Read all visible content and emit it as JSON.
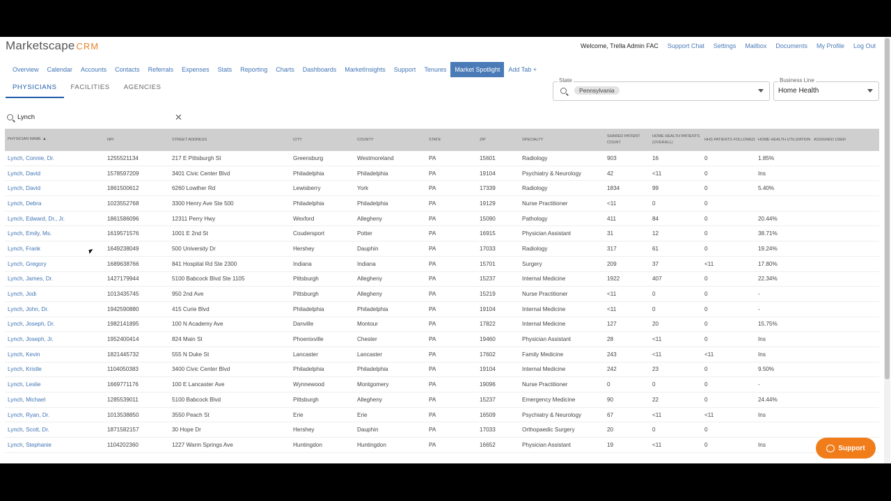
{
  "header": {
    "logo": "Marketscape",
    "logo_suffix": "CRM",
    "welcome": "Welcome, Trella Admin FAC",
    "links": [
      "Support Chat",
      "Settings",
      "Mailbox",
      "Documents",
      "My Profile",
      "Log Out"
    ]
  },
  "nav_tabs": [
    {
      "label": "Overview"
    },
    {
      "label": "Calendar"
    },
    {
      "label": "Accounts"
    },
    {
      "label": "Contacts"
    },
    {
      "label": "Referrals"
    },
    {
      "label": "Expenses"
    },
    {
      "label": "Stats"
    },
    {
      "label": "Reporting"
    },
    {
      "label": "Charts"
    },
    {
      "label": "Dashboards"
    },
    {
      "label": "MarketInsights"
    },
    {
      "label": "Support"
    },
    {
      "label": "Tenures"
    },
    {
      "label": "Market Spotlight"
    },
    {
      "label": "Add Tab +"
    }
  ],
  "active_nav": "Market Spotlight",
  "sub_tabs": [
    "PHYSICIANS",
    "FACILITIES",
    "AGENCIES"
  ],
  "filters": {
    "state_label": "State",
    "state_chip": "Pennsylvania",
    "business_line_label": "Business Line",
    "business_line_value": "Home Health"
  },
  "search": {
    "value": "Lynch"
  },
  "table": {
    "columns": [
      "PHYSICIAN NAME",
      "NPI",
      "STREET ADDRESS",
      "CITY",
      "COUNTY",
      "STATE",
      "ZIP",
      "SPECIALTY",
      "SHARED PATIENT COUNT",
      "HOME HEALTH PATIENTS (OVERALL)",
      "HHS PATIENTS FOLLOWED",
      "HOME HEALTH UTILIZATION",
      "ASSIGNED USER"
    ],
    "rows": [
      [
        "Lynch, Connie, Dr.",
        "1255521134",
        "217 E Pittsburgh St",
        "Greensburg",
        "Westmoreland",
        "PA",
        "15601",
        "Radiology",
        "903",
        "16",
        "0",
        "1.85%",
        ""
      ],
      [
        "Lynch, David",
        "1578597209",
        "3401 Civic Center Blvd",
        "Philadelphia",
        "Philadelphia",
        "PA",
        "19104",
        "Psychiatry & Neurology",
        "42",
        "<11",
        "0",
        "Ins",
        ""
      ],
      [
        "Lynch, David",
        "1861500612",
        "6260 Lowther Rd",
        "Lewisberry",
        "York",
        "PA",
        "17339",
        "Radiology",
        "1834",
        "99",
        "0",
        "5.40%",
        ""
      ],
      [
        "Lynch, Debra",
        "1023552768",
        "3300 Henry Ave Ste 500",
        "Philadelphia",
        "Philadelphia",
        "PA",
        "19129",
        "Nurse Practitioner",
        "<11",
        "0",
        "0",
        "",
        ""
      ],
      [
        "Lynch, Edward, Dr., Jr.",
        "1861586096",
        "12311 Perry Hwy",
        "Wexford",
        "Allegheny",
        "PA",
        "15090",
        "Pathology",
        "411",
        "84",
        "0",
        "20.44%",
        ""
      ],
      [
        "Lynch, Emily, Ms.",
        "1619571576",
        "1001 E 2nd St",
        "Coudersport",
        "Potter",
        "PA",
        "16915",
        "Physician Assistant",
        "31",
        "12",
        "0",
        "38.71%",
        ""
      ],
      [
        "Lynch, Frank",
        "1649238049",
        "500 University Dr",
        "Hershey",
        "Dauphin",
        "PA",
        "17033",
        "Radiology",
        "317",
        "61",
        "0",
        "19.24%",
        ""
      ],
      [
        "Lynch, Gregory",
        "1689638766",
        "841 Hospital Rd Ste 2300",
        "Indiana",
        "Indiana",
        "PA",
        "15701",
        "Surgery",
        "209",
        "37",
        "<11",
        "17.80%",
        ""
      ],
      [
        "Lynch, James, Dr.",
        "1427179944",
        "5100 Babcock Blvd Ste 1105",
        "Pittsburgh",
        "Allegheny",
        "PA",
        "15237",
        "Internal Medicine",
        "1922",
        "407",
        "0",
        "22.34%",
        ""
      ],
      [
        "Lynch, Jodi",
        "1013435745",
        "950 2nd Ave",
        "Pittsburgh",
        "Allegheny",
        "PA",
        "15219",
        "Nurse Practitioner",
        "<11",
        "0",
        "0",
        "-",
        ""
      ],
      [
        "Lynch, John, Dr.",
        "1942590880",
        "415 Curie Blvd",
        "Philadelphia",
        "Philadelphia",
        "PA",
        "19104",
        "Internal Medicine",
        "<11",
        "0",
        "0",
        "-",
        ""
      ],
      [
        "Lynch, Joseph, Dr.",
        "1982141895",
        "100 N Academy Ave",
        "Danville",
        "Montour",
        "PA",
        "17822",
        "Internal Medicine",
        "127",
        "20",
        "0",
        "15.75%",
        ""
      ],
      [
        "Lynch, Joseph, Jr.",
        "1952400414",
        "824 Main St",
        "Phoenixville",
        "Chester",
        "PA",
        "19460",
        "Physician Assistant",
        "28",
        "<11",
        "0",
        "Ins",
        ""
      ],
      [
        "Lynch, Kevin",
        "1821445732",
        "555 N Duke St",
        "Lancaster",
        "Lancaster",
        "PA",
        "17602",
        "Family Medicine",
        "243",
        "<11",
        "<11",
        "Ins",
        ""
      ],
      [
        "Lynch, Kristle",
        "1104050383",
        "3400 Civic Center Blvd",
        "Philadelphia",
        "Philadelphia",
        "PA",
        "19104",
        "Internal Medicine",
        "242",
        "23",
        "0",
        "9.50%",
        ""
      ],
      [
        "Lynch, Leslie",
        "1669771176",
        "100 E Lancaster Ave",
        "Wynnewood",
        "Montgomery",
        "PA",
        "19096",
        "Nurse Practitioner",
        "0",
        "0",
        "0",
        "-",
        ""
      ],
      [
        "Lynch, Michael",
        "1285539011",
        "5100 Babcock Blvd",
        "Pittsburgh",
        "Allegheny",
        "PA",
        "15237",
        "Emergency Medicine",
        "90",
        "22",
        "0",
        "24.44%",
        ""
      ],
      [
        "Lynch, Ryan, Dr.",
        "1013538850",
        "3550 Peach St",
        "Erie",
        "Erie",
        "PA",
        "16509",
        "Psychiatry & Neurology",
        "67",
        "<11",
        "<11",
        "Ins",
        ""
      ],
      [
        "Lynch, Scott, Dr.",
        "1871582157",
        "30 Hope Dr",
        "Hershey",
        "Dauphin",
        "PA",
        "17033",
        "Orthopaedic Surgery",
        "20",
        "0",
        "0",
        "",
        ""
      ],
      [
        "Lynch, Stephanie",
        "1104202360",
        "1227 Warm Springs Ave",
        "Huntingdon",
        "Huntingdon",
        "PA",
        "16652",
        "Physician Assistant",
        "19",
        "<11",
        "0",
        "Ins",
        ""
      ]
    ]
  },
  "support_button": "Support",
  "colors": {
    "accent": "#4a7bb7",
    "brand_orange": "#f07d1a",
    "header_bg": "#cfcfcf"
  }
}
